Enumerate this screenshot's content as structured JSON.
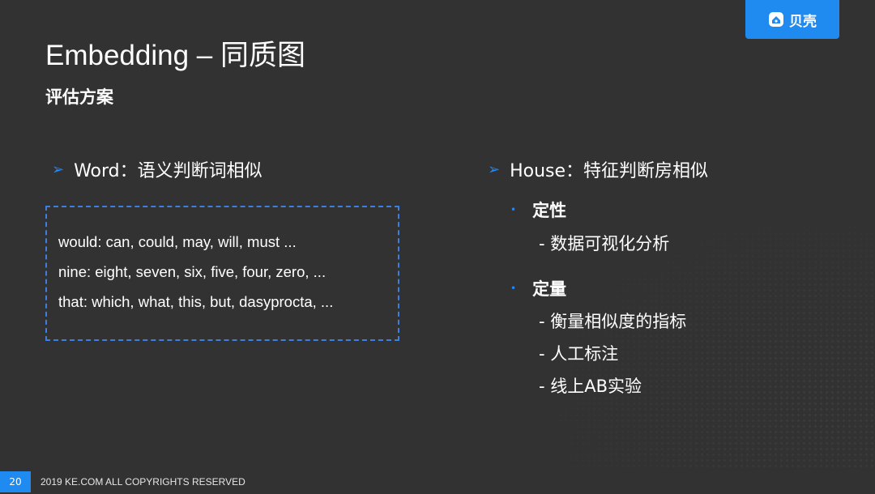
{
  "logo": {
    "text": "贝壳",
    "icon": "shell-logo-icon",
    "color": "#1f8bf0"
  },
  "title": "Embedding – 同质图",
  "subtitle": "评估方案",
  "word_section": {
    "heading": "Word：语义判断词相似",
    "examples": [
      "would: can, could, may, will, must ...",
      "nine: eight, seven, six, five, four, zero, ...",
      "that: which, what, this, but, dasyprocta, ..."
    ]
  },
  "house_section": {
    "heading": "House：特征判断房相似",
    "qualitative": {
      "label": "定性",
      "items": [
        "- 数据可视化分析"
      ]
    },
    "quantitative": {
      "label": "定量",
      "items": [
        "- 衡量相似度的指标",
        "- 人工标注",
        "- 线上AB实验"
      ]
    }
  },
  "footer": {
    "page_number": "20",
    "copyright": "2019 KE.COM ALL COPYRIGHTS RESERVED"
  },
  "colors": {
    "background": "#323232",
    "accent": "#1e88ff",
    "dashed_border": "#3d7fe0"
  }
}
